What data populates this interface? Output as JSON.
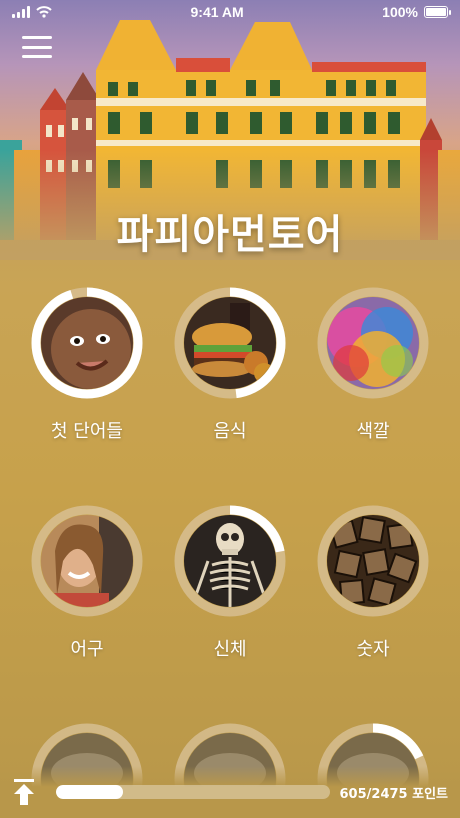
{
  "status_bar": {
    "time": "9:41 AM",
    "battery": "100%"
  },
  "title": "파피아먼토어",
  "topics": [
    {
      "label": "첫 단어들",
      "progress": 0.95,
      "image": "baby-face-photo"
    },
    {
      "label": "음식",
      "progress": 0.48,
      "image": "burger-photo"
    },
    {
      "label": "색깔",
      "progress": 0,
      "image": "colorful-powder-photo"
    },
    {
      "label": "어구",
      "progress": 0,
      "image": "smiling-woman-photo"
    },
    {
      "label": "신체",
      "progress": 0.22,
      "image": "skeleton-photo"
    },
    {
      "label": "숫자",
      "progress": 0,
      "image": "number-blocks-photo"
    },
    {
      "label": "",
      "progress": 0,
      "image": "partial-topic-photo"
    },
    {
      "label": "",
      "progress": 0,
      "image": "partial-topic-photo"
    },
    {
      "label": "",
      "progress": 0.18,
      "image": "partial-topic-photo"
    }
  ],
  "bottom": {
    "points_text": "605/2475 포인트",
    "progress": 0.244
  },
  "colors": {
    "ring_track": "#d9c39b",
    "ring_fill": "#ffffff"
  }
}
